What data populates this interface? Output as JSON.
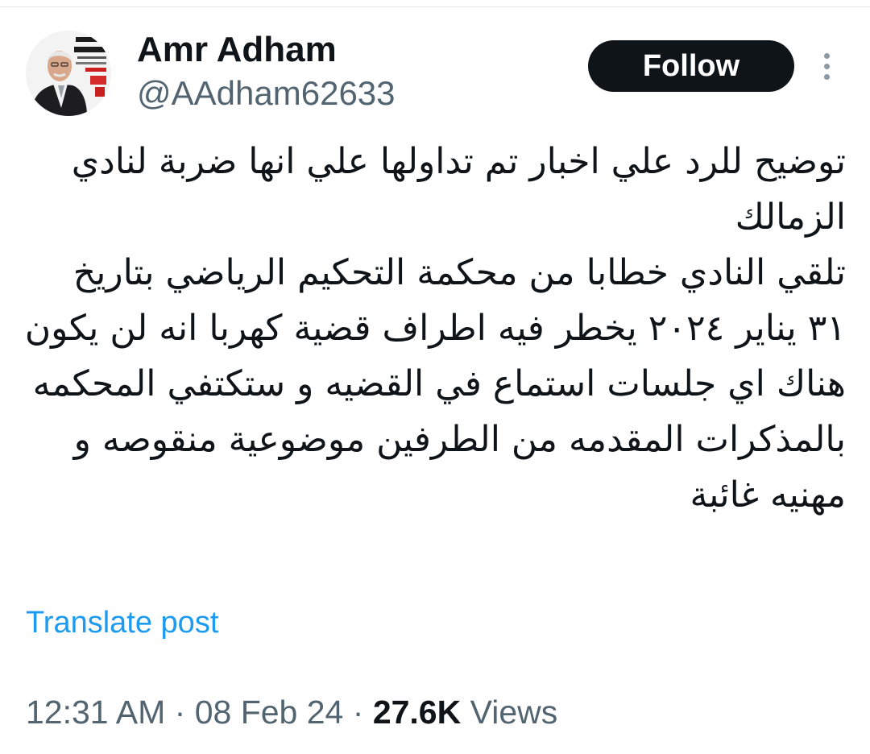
{
  "author": {
    "display_name": "Amr Adham",
    "handle": "@AAdham62633",
    "avatar_icon": "profile-photo"
  },
  "actions": {
    "follow_label": "Follow",
    "more_icon": "vertical-ellipsis-icon"
  },
  "tweet": {
    "paragraphs": [
      "توضيح للرد علي اخبار تم تداولها علي انها ضربة لنادي الزمالك",
      "تلقي النادي خطابا من محكمة التحكيم الرياضي بتاريخ ٣١ يناير ٢٠٢٤ يخطر فيه اطراف قضية كهربا انه لن يكون هناك اي جلسات استماع في القضيه و ستكتفي المحكمه بالمذكرات المقدمه من الطرفين موضوعية منقوصه و مهنيه غائبة"
    ]
  },
  "translate_label": "Translate post",
  "meta": {
    "time": "12:31 AM",
    "separator": "·",
    "date": "08 Feb 24",
    "views_count": "27.6K",
    "views_label": "Views"
  },
  "colors": {
    "text_primary": "#0f1419",
    "text_secondary": "#536471",
    "link": "#1d9bf0",
    "follow_bg": "#0f1419",
    "follow_text": "#ffffff"
  }
}
